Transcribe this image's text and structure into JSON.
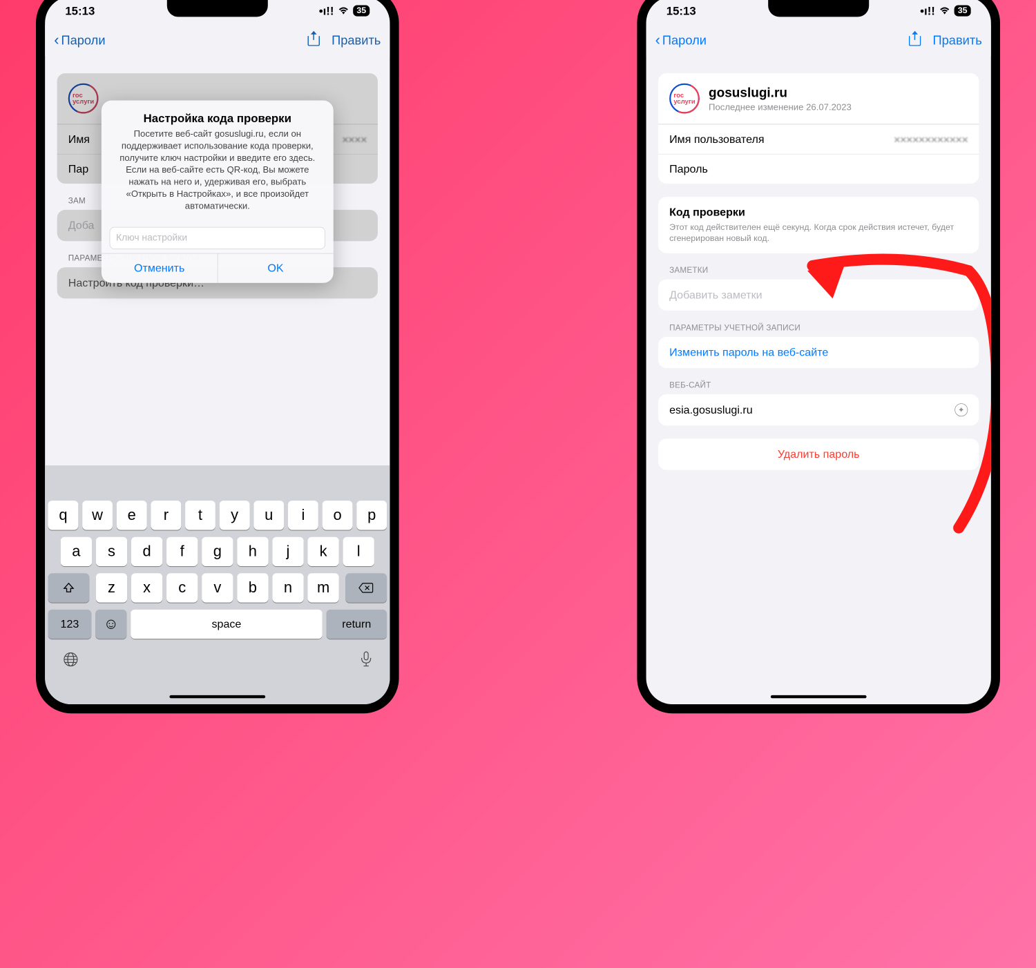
{
  "status": {
    "time": "15:13",
    "signal": "••!!",
    "battery": "35"
  },
  "nav": {
    "back": "Пароли",
    "edit": "Править"
  },
  "site": {
    "domain": "gosuslugi.ru",
    "last_modified": "Последнее изменение 26.07.2023",
    "logo_top": "гос",
    "logo_bottom": "услуги"
  },
  "fields": {
    "username_label": "Имя пользователя",
    "username_value": "✕✕✕✕✕✕✕✕✕✕✕✕",
    "password_label": "Пароль",
    "username_label_short": "Имя",
    "password_label_short": "Пар"
  },
  "verify": {
    "title": "Код проверки",
    "desc_a": "Этот код действителен ещё",
    "desc_b": "секунд. Когда срок действия истечет, будет сгенерирован новый код."
  },
  "notes": {
    "header": "ЗАМЕТКИ",
    "header_short": "ЗАМ",
    "placeholder": "Добавить заметки",
    "placeholder_short": "Доба"
  },
  "account_opts": {
    "header": "ПАРАМЕТРЫ УЧЕТНОЙ ЗАПИСИ",
    "setup_code": "Настроить код проверки…",
    "change_pw": "Изменить пароль на веб-сайте"
  },
  "website": {
    "header": "ВЕБ-САЙТ",
    "value": "esia.gosuslugi.ru"
  },
  "delete": {
    "label": "Удалить пароль"
  },
  "alert": {
    "title": "Настройка кода проверки",
    "body": "Посетите веб-сайт gosuslugi.ru, если он поддерживает использование кода проверки, получите ключ настройки и введите его здесь. Если на веб-сайте есть QR-код, Вы можете нажать на него и, удерживая его, выбрать «Открыть в Настройках», и все произойдет автоматически.",
    "placeholder": "Ключ настройки",
    "cancel": "Отменить",
    "ok": "OK"
  },
  "keyboard": {
    "row1": [
      "q",
      "w",
      "e",
      "r",
      "t",
      "y",
      "u",
      "i",
      "o",
      "p"
    ],
    "row2": [
      "a",
      "s",
      "d",
      "f",
      "g",
      "h",
      "j",
      "k",
      "l"
    ],
    "row3": [
      "z",
      "x",
      "c",
      "v",
      "b",
      "n",
      "m"
    ],
    "numkey": "123",
    "space": "space",
    "return": "return"
  }
}
